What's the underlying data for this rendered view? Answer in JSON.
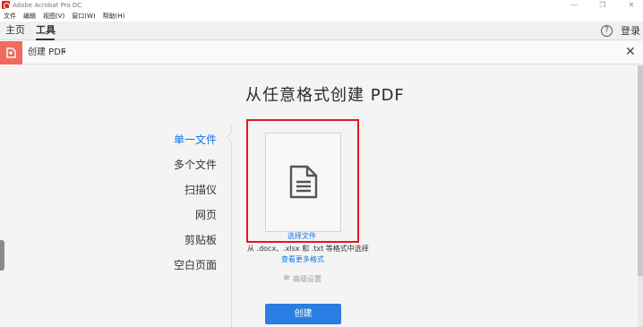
{
  "window": {
    "title": "Adobe Acrobat Pro DC",
    "minimize_glyph": "—",
    "restore_glyph": "❐",
    "close_glyph": "✕"
  },
  "menu": {
    "items": [
      "文件",
      "编辑",
      "视图(V)",
      "窗口(W)",
      "帮助(H)"
    ]
  },
  "nav": {
    "home_label": "主页",
    "tools_label": "工具",
    "help_glyph": "?",
    "login_label": "登录"
  },
  "toolbar": {
    "tool_name": "创建 PDF",
    "caret": "▾",
    "close_glyph": "✕",
    "icon": "create-pdf-icon",
    "accent_color": "#ee6b60"
  },
  "main": {
    "title": "从任意格式创建 PDF",
    "sources": [
      {
        "label": "单一文件",
        "active": true
      },
      {
        "label": "多个文件",
        "active": false
      },
      {
        "label": "扫描仪",
        "active": false
      },
      {
        "label": "网页",
        "active": false
      },
      {
        "label": "剪贴板",
        "active": false
      },
      {
        "label": "空白页面",
        "active": false
      }
    ],
    "select_file_label": "选择文件",
    "hint": "从 .docx、.xlsx 和 .txt 等格式中选择",
    "more_formats_label": "查看更多格式",
    "advanced_label": "高级设置",
    "gear_glyph": "✲",
    "create_button_label": "创建",
    "link_color": "#1473e6",
    "highlight_color": "#e8151c"
  }
}
